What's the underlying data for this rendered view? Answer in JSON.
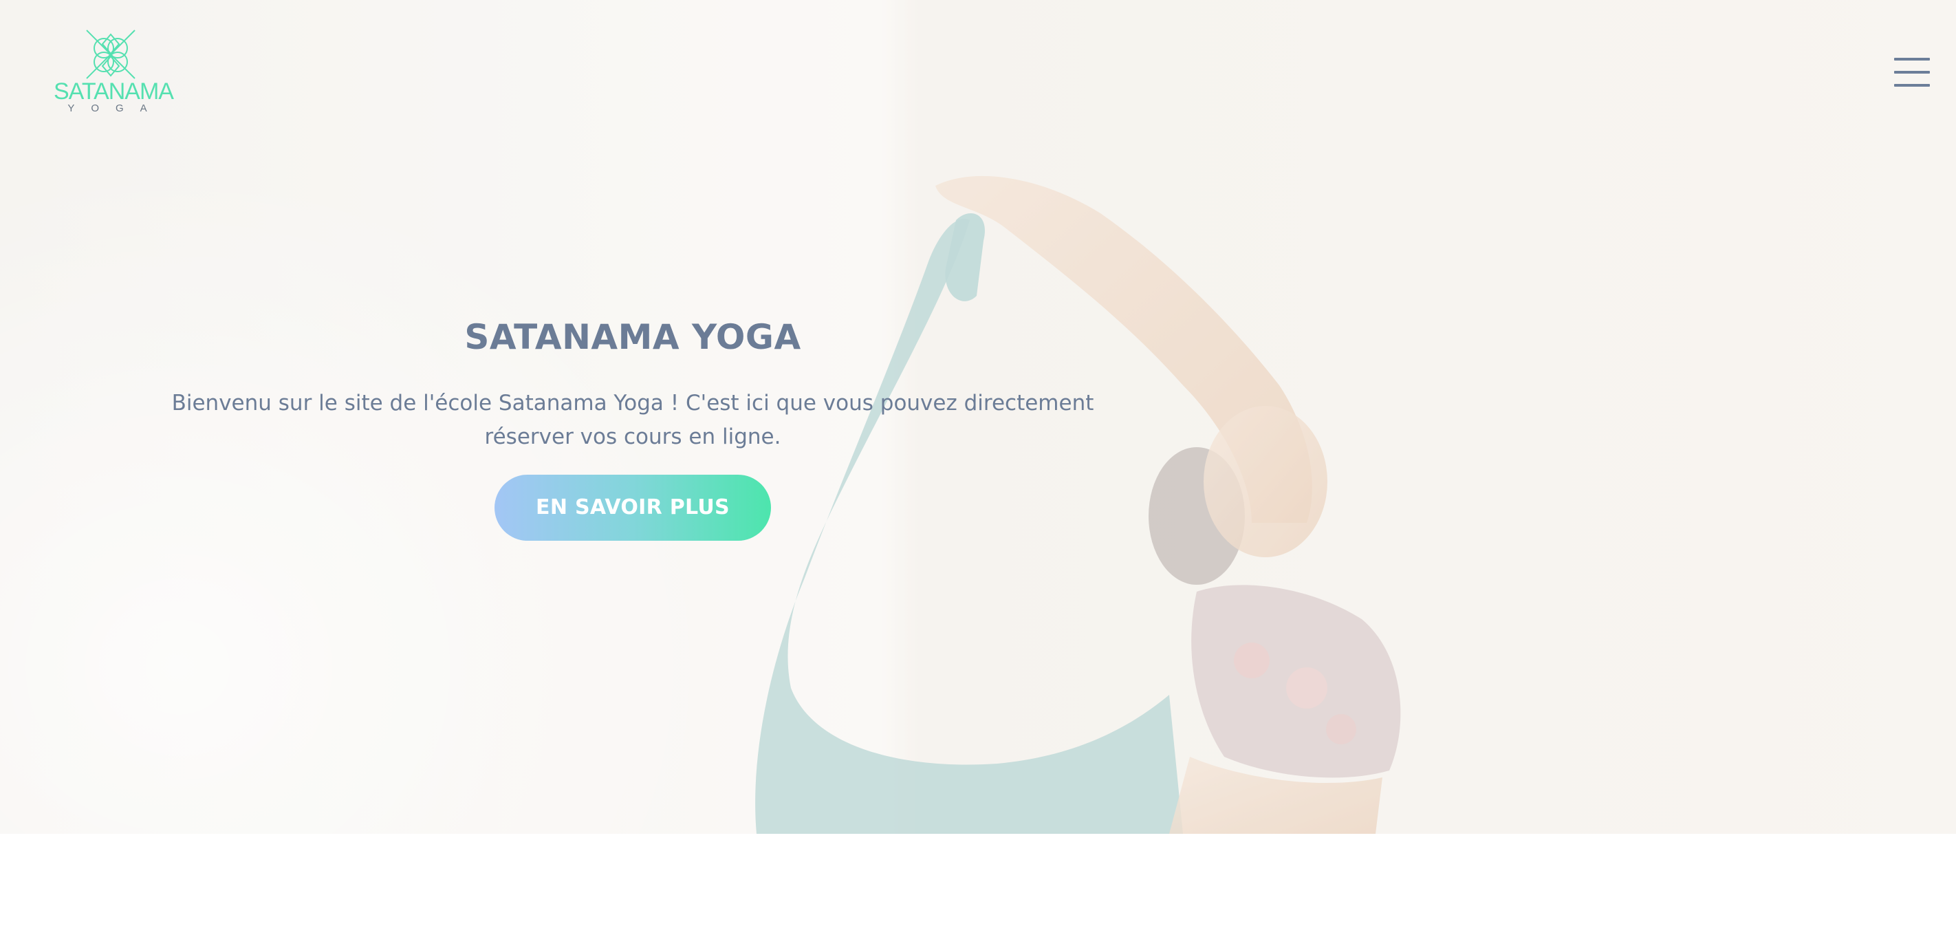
{
  "header": {
    "logo_text": "SATANAMA",
    "logo_subtext": "YOGA",
    "menu_icon": "hamburger-menu-icon"
  },
  "hero": {
    "title": "SATANAMA YOGA",
    "text": "Bienvenu sur le site de l'école Satanama Yoga ! C'est ici que vous pouvez directement réserver vos cours en ligne.",
    "cta_label": "EN SAVOIR PLUS"
  },
  "colors": {
    "brand_green": "#55e0b0",
    "text_slate": "#6b7c96",
    "button_gradient_start": "#a3c6f5",
    "button_gradient_end": "#4de5ad"
  }
}
